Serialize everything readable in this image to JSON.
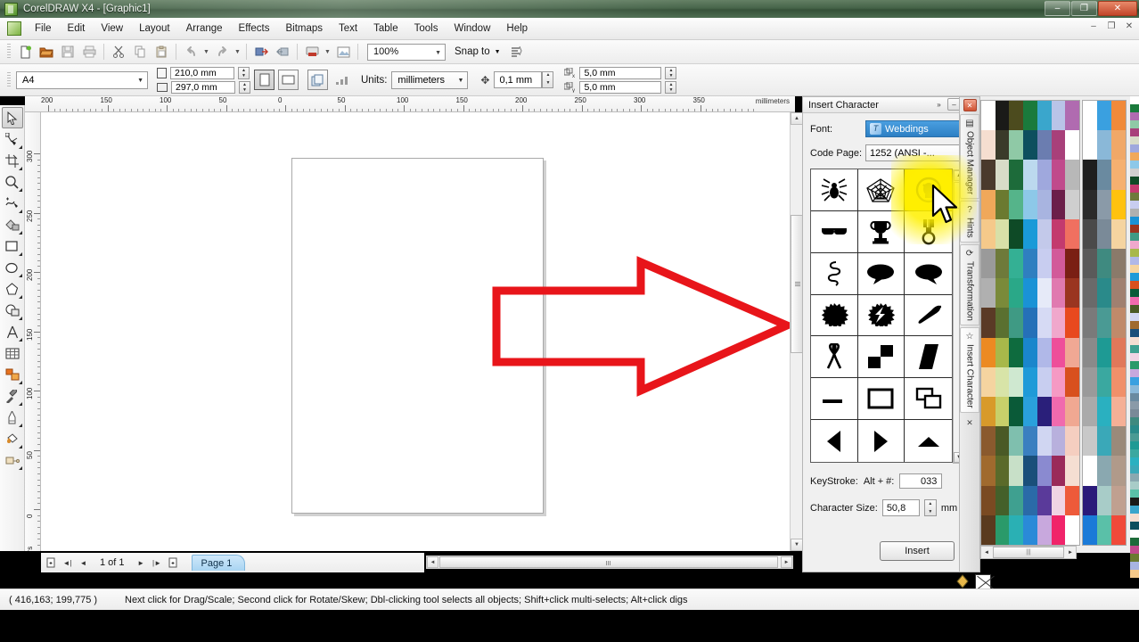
{
  "window": {
    "title": "CorelDRAW X4 - [Graphic1]",
    "app_icon": "coreldraw-icon",
    "minimize": "–",
    "maximize": "❐",
    "close": "✕",
    "mdi_minimize": "–",
    "mdi_restore": "❐",
    "mdi_close": "✕"
  },
  "menu": {
    "items": [
      {
        "label": "File",
        "accel": "F"
      },
      {
        "label": "Edit",
        "accel": "E"
      },
      {
        "label": "View",
        "accel": "V"
      },
      {
        "label": "Layout",
        "accel": "L"
      },
      {
        "label": "Arrange",
        "accel": "A"
      },
      {
        "label": "Effects",
        "accel": "c"
      },
      {
        "label": "Bitmaps",
        "accel": "B"
      },
      {
        "label": "Text",
        "accel": "T"
      },
      {
        "label": "Table",
        "accel": "a"
      },
      {
        "label": "Tools",
        "accel": "o"
      },
      {
        "label": "Window",
        "accel": "W"
      },
      {
        "label": "Help",
        "accel": "H"
      }
    ]
  },
  "toolbar": {
    "buttons": [
      {
        "name": "new-document-button",
        "icon": "new-page-icon"
      },
      {
        "name": "open-document-button",
        "icon": "folder-open-icon"
      },
      {
        "name": "save-button",
        "icon": "floppy-disk-icon"
      },
      {
        "name": "print-button",
        "icon": "printer-icon"
      },
      {
        "name": "cut-button",
        "icon": "scissors-icon"
      },
      {
        "name": "copy-button",
        "icon": "copy-icon"
      },
      {
        "name": "paste-button",
        "icon": "clipboard-icon"
      },
      {
        "name": "undo-button",
        "icon": "undo-arrow-icon"
      },
      {
        "name": "redo-button",
        "icon": "redo-arrow-icon"
      },
      {
        "name": "import-button",
        "icon": "import-icon"
      },
      {
        "name": "export-button",
        "icon": "export-icon"
      },
      {
        "name": "application-launcher-button",
        "icon": "launcher-icon"
      },
      {
        "name": "corel-online-button",
        "icon": "online-icon"
      }
    ],
    "zoom_level": "100%",
    "snap_to_label": "Snap to",
    "options_icon": "options-icon"
  },
  "propertybar": {
    "page_size": "A4",
    "page_width": "210,0 mm",
    "page_height": "297,0 mm",
    "orientation_portrait_icon": "portrait-icon",
    "orientation_landscape_icon": "landscape-icon",
    "all_pages_icon": "all-pages-icon",
    "current_page_icon": "current-page-icon",
    "units_label": "Units:",
    "units_value": "millimeters",
    "nudge_icon": "nudge-icon",
    "nudge_value": "0,1 mm",
    "duplicate_x_label": "x",
    "duplicate_x_value": "5,0 mm",
    "duplicate_y_label": "y",
    "duplicate_y_value": "5,0 mm"
  },
  "toolbox": {
    "tools": [
      {
        "name": "pick-tool",
        "icon": "arrow-cursor-icon",
        "selected": true
      },
      {
        "name": "shape-tool",
        "icon": "node-edit-icon",
        "selected": false
      },
      {
        "name": "crop-tool",
        "icon": "crop-icon",
        "selected": false
      },
      {
        "name": "zoom-tool",
        "icon": "magnifier-icon",
        "selected": false
      },
      {
        "name": "freehand-tool",
        "icon": "freehand-pen-icon",
        "selected": false
      },
      {
        "name": "smart-fill-tool",
        "icon": "smart-fill-icon",
        "selected": false
      },
      {
        "name": "rectangle-tool",
        "icon": "rectangle-icon",
        "selected": false
      },
      {
        "name": "ellipse-tool",
        "icon": "ellipse-icon",
        "selected": false
      },
      {
        "name": "polygon-tool",
        "icon": "polygon-icon",
        "selected": false
      },
      {
        "name": "basic-shapes-tool",
        "icon": "basic-shapes-icon",
        "selected": false
      },
      {
        "name": "text-tool",
        "icon": "letter-a-icon",
        "selected": false
      },
      {
        "name": "table-tool",
        "icon": "table-grid-icon",
        "selected": false
      },
      {
        "name": "blend-tool",
        "icon": "blend-icon",
        "selected": false
      },
      {
        "name": "eyedropper-tool",
        "icon": "eyedropper-icon",
        "selected": false
      },
      {
        "name": "outline-tool",
        "icon": "outline-pen-icon",
        "selected": false
      },
      {
        "name": "fill-tool",
        "icon": "paint-bucket-icon",
        "selected": false
      },
      {
        "name": "interactive-fill-tool",
        "icon": "interactive-fill-icon",
        "selected": false
      }
    ]
  },
  "rulers": {
    "unit_label": "millimeters",
    "horizontal_labels": [
      "200",
      "150",
      "100",
      "50",
      "0",
      "50",
      "100",
      "150",
      "200",
      "250",
      "300",
      "350"
    ],
    "vertical_labels": [
      "300",
      "250",
      "200",
      "150",
      "100",
      "50",
      "0"
    ]
  },
  "canvas": {
    "annotation": "red-arrow-overlay",
    "annotation_color": "#e8151a"
  },
  "pagenav": {
    "first_page_icon": "first-page-icon",
    "prev_page_icon": "prev-page-icon",
    "counter": "1 of 1",
    "next_page_icon": "next-page-icon",
    "last_page_icon": "last-page-icon",
    "add_page_icon": "add-page-icon",
    "tab_label": "Page 1"
  },
  "statusbar": {
    "coordinates": "( 416,163; 199,775 )",
    "hint": "Next click for Drag/Scale; Second click for Rotate/Skew; Dbl-clicking tool selects all objects; Shift+click multi-selects; Alt+click digs",
    "fill_label": "fill-indicator",
    "outline_label": "outline-indicator",
    "fill_color": "#000000",
    "outline_color": "none"
  },
  "docker": {
    "title": "Insert Character",
    "chevron": "»",
    "minimize": "–",
    "close": "✕",
    "font_label": "Font:",
    "font_label_accel": "F",
    "font_value": "Webdings",
    "font_icon": "truetype-icon",
    "codepage_label": "Code Page:",
    "codepage_label_accel": "C",
    "codepage_value": "1252  (ANSI -...",
    "characters": [
      {
        "name": "spider-glyph",
        "row": 1,
        "col": 1,
        "highlighted": false
      },
      {
        "name": "spider-web-glyph",
        "row": 1,
        "col": 2,
        "highlighted": false
      },
      {
        "name": "no-smoking-face-glyph",
        "row": 1,
        "col": 3,
        "highlighted": true
      },
      {
        "name": "sunglasses-glyph",
        "row": 2,
        "col": 1,
        "highlighted": false
      },
      {
        "name": "trophy-glyph",
        "row": 2,
        "col": 2,
        "highlighted": false
      },
      {
        "name": "medal-glyph",
        "row": 2,
        "col": 3,
        "highlighted": false
      },
      {
        "name": "ribbon-squiggle-glyph",
        "row": 3,
        "col": 1,
        "highlighted": false
      },
      {
        "name": "speech-bubble-left-glyph",
        "row": 3,
        "col": 2,
        "highlighted": false
      },
      {
        "name": "speech-bubble-right-glyph",
        "row": 3,
        "col": 3,
        "highlighted": false
      },
      {
        "name": "starburst-glyph",
        "row": 4,
        "col": 1,
        "highlighted": false
      },
      {
        "name": "lightning-burst-glyph",
        "row": 4,
        "col": 2,
        "highlighted": false
      },
      {
        "name": "chili-pepper-glyph",
        "row": 4,
        "col": 3,
        "highlighted": false
      },
      {
        "name": "awareness-ribbon-glyph",
        "row": 5,
        "col": 1,
        "highlighted": false
      },
      {
        "name": "checker-squares-glyph",
        "row": 5,
        "col": 2,
        "highlighted": false
      },
      {
        "name": "parallelogram-glyph",
        "row": 5,
        "col": 3,
        "highlighted": false
      },
      {
        "name": "horizontal-bar-glyph",
        "row": 6,
        "col": 1,
        "highlighted": false
      },
      {
        "name": "rectangle-outline-glyph",
        "row": 6,
        "col": 2,
        "highlighted": false
      },
      {
        "name": "stacked-windows-glyph",
        "row": 6,
        "col": 3,
        "highlighted": false
      },
      {
        "name": "triangle-left-glyph",
        "row": 7,
        "col": 1,
        "highlighted": false
      },
      {
        "name": "triangle-right-glyph",
        "row": 7,
        "col": 2,
        "highlighted": false
      },
      {
        "name": "triangle-up-glyph",
        "row": 7,
        "col": 3,
        "highlighted": false
      }
    ],
    "keystroke_label": "KeyStroke:",
    "keystroke_alt_label": "Alt + #:",
    "keystroke_accel": "#",
    "keystroke_value": "033",
    "charsize_label": "Character Size:",
    "charsize_accel": "S",
    "charsize_value": "50,8",
    "charsize_unit": "mm",
    "insert_button": "Insert",
    "insert_accel": "I"
  },
  "docker_tabs": {
    "close_icon": "✕",
    "items": [
      {
        "label": "Object Manager",
        "icon": "layers-icon",
        "active": false
      },
      {
        "label": "Hints",
        "icon": "question-mark-icon",
        "active": false
      },
      {
        "label": "Transformation",
        "icon": "transform-icon",
        "active": false
      },
      {
        "label": "Insert Character",
        "icon": "star-icon",
        "active": true
      }
    ],
    "bottom_close": "✕"
  },
  "palette": {
    "nav_left_icon": "◄",
    "nav_right_icon": "►",
    "nav_grip": "|||",
    "colors_main": [
      "#ffffff",
      "#1a1a18",
      "#4c4b1e",
      "#1a7a3c",
      "#3aa6cc",
      "#b9c4e8",
      "#b06bb0",
      "#f5ded0",
      "#3a3a2a",
      "#8fc9a6",
      "#0d4f5e",
      "#6b7db0",
      "#a8407a",
      "#ffffff",
      "#4a3a2c",
      "#d8dcc8",
      "#1d6b3a",
      "#bcd9ee",
      "#9fa8dd",
      "#c04a8c",
      "#b8b8b8",
      "#f0a85a",
      "#6b7a30",
      "#55b48a",
      "#8dc8e8",
      "#a8b4e0",
      "#6b1f4a",
      "#cfcfcf",
      "#f5c98a",
      "#d8e0a8",
      "#0e4a26",
      "#1a9ad8",
      "#c3c9ea",
      "#c33a6e",
      "#f07060",
      "#9a9a9a",
      "#6e7a3a",
      "#34b094",
      "#2f7fc0",
      "#c8cdf0",
      "#d25a9a",
      "#7a1f14",
      "#b0b0b0",
      "#7a8a3a",
      "#2aa888",
      "#1a92d6",
      "#e6eaf8",
      "#e07ab0",
      "#9a3520",
      "#5a3a26",
      "#5a7030",
      "#3f9a84",
      "#2570b8",
      "#d6daf4",
      "#f0a8cc",
      "#e8491e",
      "#ec8a22",
      "#a8b84a",
      "#0e6b3e",
      "#1a86cc",
      "#b0b8e8",
      "#ee4f9a",
      "#f0a894",
      "#f5d4a0",
      "#d8e4a8",
      "#cfe8d0",
      "#1f9ad8",
      "#c8cef0",
      "#f59ac4",
      "#d8501e",
      "#d89a2a",
      "#c8d06a",
      "#0a5a38",
      "#2aa0dc",
      "#2a1f7a",
      "#f06aae",
      "#f0a892",
      "#8a5a2e",
      "#4a5a26",
      "#7fbfae",
      "#3a7fc0",
      "#d0d6f2",
      "#b8b0dd",
      "#f5cec0",
      "#a06a2e",
      "#5a6a2a",
      "#c8e0c8",
      "#1a4f7a",
      "#8a8ad0",
      "#9a2a5a",
      "#f5ded2",
      "#7a4a22",
      "#44602a",
      "#3fa090",
      "#2a6aa8",
      "#5a3a9a",
      "#f0d4e4",
      "#ee5a3a",
      "#5a3a1e",
      "#2a9a6a",
      "#2ab0b4",
      "#2a8ad8",
      "#c8a8dd",
      "#f0246a"
    ],
    "colors_second": [
      "#ffffff",
      "#3aa0e0",
      "#f08a3a",
      "#ffffff",
      "#8ab8d8",
      "#f0a868",
      "#1e1e1e",
      "#6a8aa0",
      "#f5b070",
      "#2a2a2a",
      "#8a9aa8",
      "#ffc20e",
      "#4a4a4a",
      "#7a8a98",
      "#f5d4a0",
      "#5a5a5a",
      "#3f8a80",
      "#8a7a6a",
      "#6a6a6a",
      "#2a8a8a",
      "#a08070",
      "#7a7a7a",
      "#4a9a94",
      "#c08a6a",
      "#8a8a8a",
      "#1e9a94",
      "#e0785a",
      "#9a9a9a",
      "#3aa8a0",
      "#f0906a",
      "#aaaaaa",
      "#2ab0c0",
      "#f5b096",
      "#c8c8c8",
      "#3aa8b8",
      "#9a8a7a",
      "#ffffff",
      "#8aa8b0",
      "#b09a8a",
      "#2a1a7a",
      "#a8ccc8",
      "#c0a090",
      "#1a7ad8",
      "#5ac0a8",
      "#f04a3a"
    ]
  }
}
